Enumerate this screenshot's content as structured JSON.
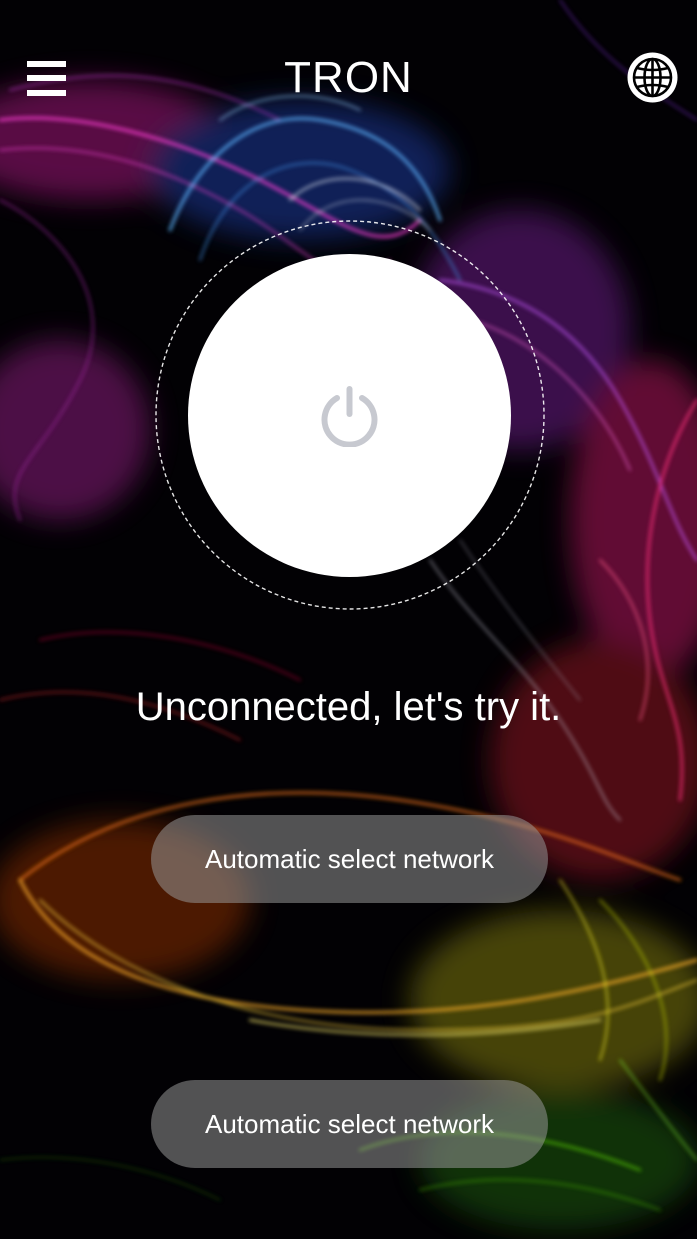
{
  "header": {
    "title": "TRON",
    "menu_icon": "hamburger-menu-icon",
    "globe_icon": "globe-icon"
  },
  "power": {
    "icon": "power-icon",
    "state": "off"
  },
  "status": {
    "text": "Unconnected, let's try it."
  },
  "buttons": [
    {
      "label": "Automatic select network"
    },
    {
      "label": "Automatic select network"
    }
  ],
  "colors": {
    "background": "#000000",
    "foreground": "#ffffff",
    "power_icon": "#c7c9d0",
    "button_fill": "#8c8c8c"
  }
}
